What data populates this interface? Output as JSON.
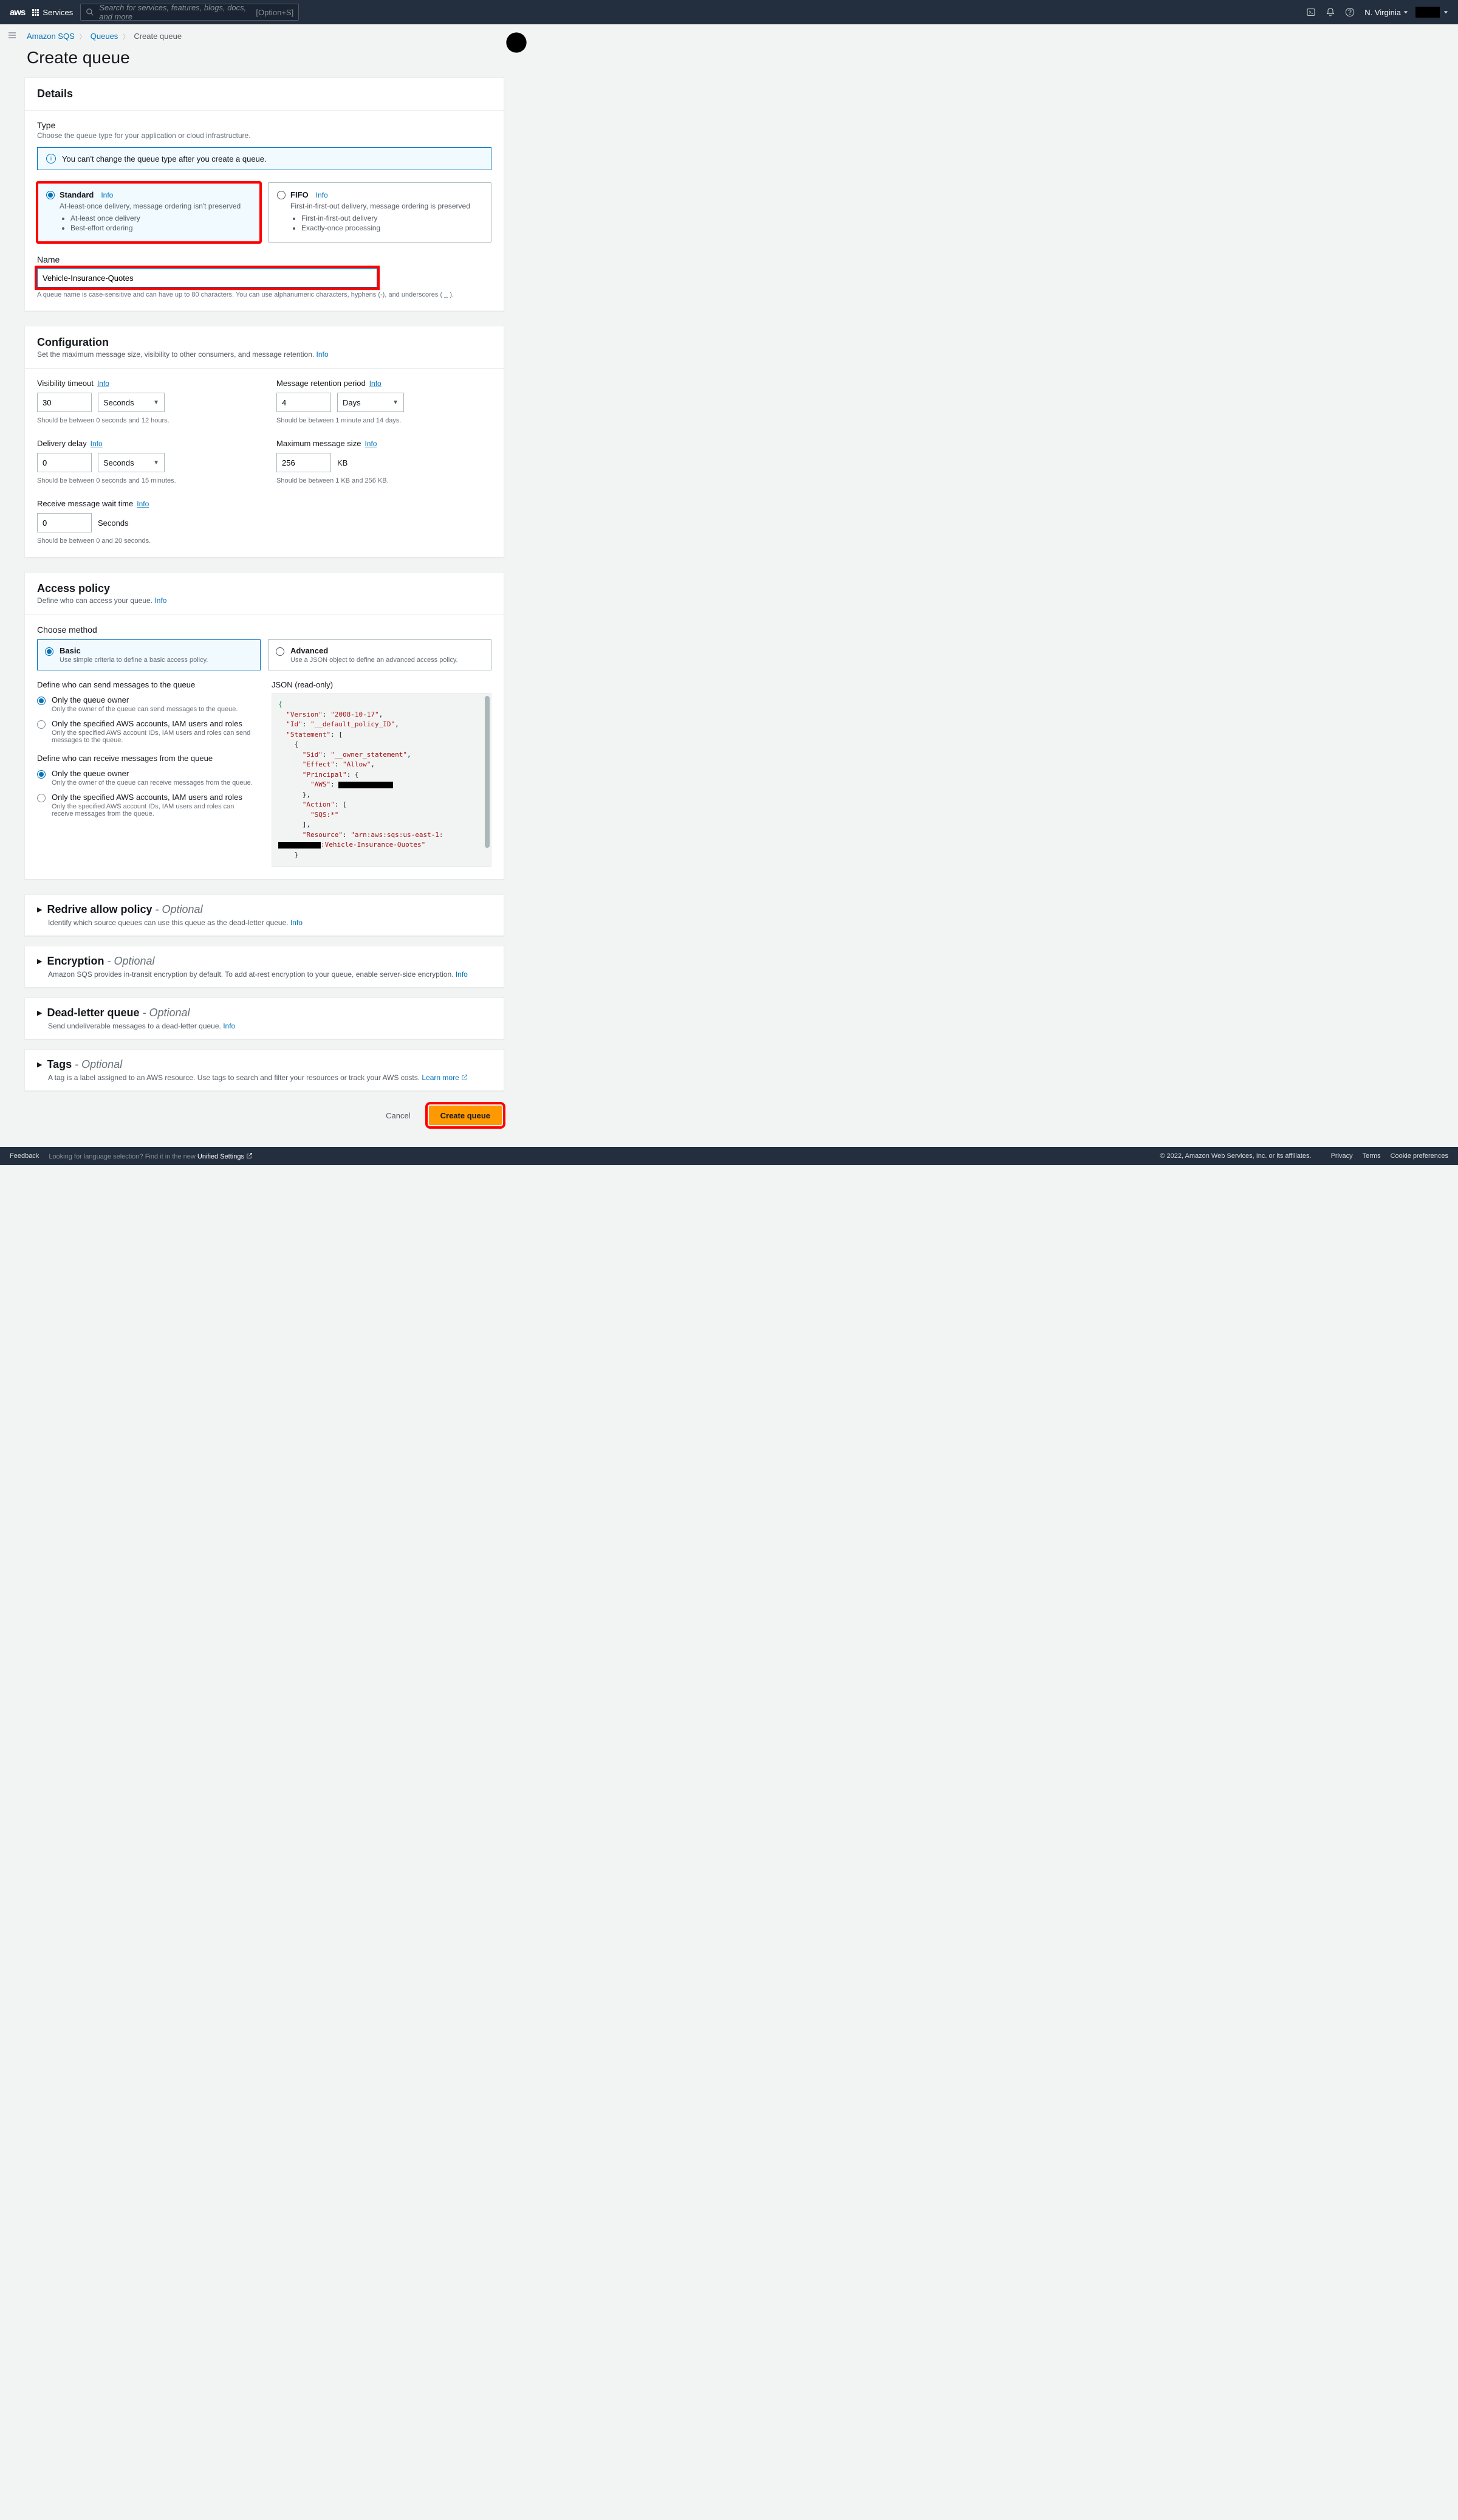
{
  "topnav": {
    "logo": "aws",
    "services": "Services",
    "search_placeholder": "Search for services, features, blogs, docs, and more",
    "search_shortcut": "[Option+S]",
    "region": "N. Virginia"
  },
  "breadcrumb": {
    "root": "Amazon SQS",
    "queues": "Queues",
    "current": "Create queue"
  },
  "page_title": "Create queue",
  "details": {
    "heading": "Details",
    "type_label": "Type",
    "type_sub": "Choose the queue type for your application or cloud infrastructure.",
    "info_banner": "You can't change the queue type after you create a queue.",
    "standard": {
      "title": "Standard",
      "info": "Info",
      "desc": "At-least-once delivery, message ordering isn't preserved",
      "b1": "At-least once delivery",
      "b2": "Best-effort ordering"
    },
    "fifo": {
      "title": "FIFO",
      "info": "Info",
      "desc": "First-in-first-out delivery, message ordering is preserved",
      "b1": "First-in-first-out delivery",
      "b2": "Exactly-once processing"
    },
    "name_label": "Name",
    "name_value": "Vehicle-Insurance-Quotes",
    "name_hint": "A queue name is case-sensitive and can have up to 80 characters. You can use alphanumeric characters, hyphens (-), and underscores ( _ )."
  },
  "config": {
    "heading": "Configuration",
    "sub": "Set the maximum message size, visibility to other consumers, and message retention.",
    "info": "Info",
    "visibility": {
      "label": "Visibility timeout",
      "info": "Info",
      "value": "30",
      "unit": "Seconds",
      "hint": "Should be between 0 seconds and 12 hours."
    },
    "retention": {
      "label": "Message retention period",
      "info": "Info",
      "value": "4",
      "unit": "Days",
      "hint": "Should be between 1 minute and 14 days."
    },
    "delay": {
      "label": "Delivery delay",
      "info": "Info",
      "value": "0",
      "unit": "Seconds",
      "hint": "Should be between 0 seconds and 15 minutes."
    },
    "maxsize": {
      "label": "Maximum message size",
      "info": "Info",
      "value": "256",
      "unit": "KB",
      "hint": "Should be between 1 KB and 256 KB."
    },
    "wait": {
      "label": "Receive message wait time",
      "info": "Info",
      "value": "0",
      "unit": "Seconds",
      "hint": "Should be between 0 and 20 seconds."
    }
  },
  "access": {
    "heading": "Access policy",
    "sub": "Define who can access your queue.",
    "info": "Info",
    "choose_method": "Choose method",
    "basic": {
      "title": "Basic",
      "desc": "Use simple criteria to define a basic access policy."
    },
    "advanced": {
      "title": "Advanced",
      "desc": "Use a JSON object to define an advanced access policy."
    },
    "send_q": "Define who can send messages to the queue",
    "send_owner": {
      "title": "Only the queue owner",
      "desc": "Only the owner of the queue can send messages to the queue."
    },
    "send_spec": {
      "title": "Only the specified AWS accounts, IAM users and roles",
      "desc": "Only the specified AWS account IDs, IAM users and roles can send messages to the queue."
    },
    "recv_q": "Define who can receive messages from the queue",
    "recv_owner": {
      "title": "Only the queue owner",
      "desc": "Only the owner of the queue can receive messages from the queue."
    },
    "recv_spec": {
      "title": "Only the specified AWS accounts, IAM users and roles",
      "desc": "Only the specified AWS account IDs, IAM users and roles can receive messages from the queue."
    },
    "json_label": "JSON (read-only)",
    "json": {
      "version_k": "\"Version\"",
      "version_v": "\"2008-10-17\"",
      "id_k": "\"Id\"",
      "id_v": "\"__default_policy_ID\"",
      "stmt_k": "\"Statement\"",
      "sid_k": "\"Sid\"",
      "sid_v": "\"__owner_statement\"",
      "effect_k": "\"Effect\"",
      "effect_v": "\"Allow\"",
      "principal_k": "\"Principal\"",
      "aws_k": "\"AWS\"",
      "action_k": "\"Action\"",
      "action_v": "\"SQS:*\"",
      "resource_k": "\"Resource\"",
      "resource_prefix": "\"arn:aws:sqs:us-east-1:",
      "resource_suffix": ":Vehicle-Insurance-Quotes\""
    }
  },
  "collapsibles": {
    "redrive": {
      "title": "Redrive allow policy",
      "opt": " - Optional",
      "desc": "Identify which source queues can use this queue as the dead-letter queue.",
      "info": "Info"
    },
    "encryption": {
      "title": "Encryption",
      "opt": " - Optional",
      "desc": "Amazon SQS provides in-transit encryption by default. To add at-rest encryption to your queue, enable server-side encryption.",
      "info": "Info"
    },
    "dlq": {
      "title": "Dead-letter queue",
      "opt": " - Optional",
      "desc": "Send undeliverable messages to a dead-letter queue.",
      "info": "Info"
    },
    "tags": {
      "title": "Tags",
      "opt": " - Optional",
      "desc": "A tag is a label assigned to an AWS resource. Use tags to search and filter your resources or track your AWS costs.",
      "learn": "Learn more"
    }
  },
  "actions": {
    "cancel": "Cancel",
    "create": "Create queue"
  },
  "footer": {
    "feedback": "Feedback",
    "lang_prefix": "Looking for language selection? Find it in the new ",
    "lang_link": "Unified Settings",
    "copy": "© 2022, Amazon Web Services, Inc. or its affiliates.",
    "privacy": "Privacy",
    "terms": "Terms",
    "cookie": "Cookie preferences"
  }
}
